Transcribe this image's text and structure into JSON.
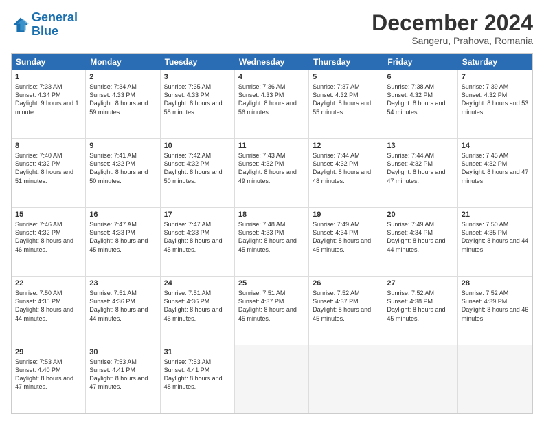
{
  "logo": {
    "line1": "General",
    "line2": "Blue"
  },
  "title": "December 2024",
  "subtitle": "Sangeru, Prahova, Romania",
  "header_days": [
    "Sunday",
    "Monday",
    "Tuesday",
    "Wednesday",
    "Thursday",
    "Friday",
    "Saturday"
  ],
  "weeks": [
    [
      {
        "day": "1",
        "sunrise": "Sunrise: 7:33 AM",
        "sunset": "Sunset: 4:34 PM",
        "daylight": "Daylight: 9 hours and 1 minute."
      },
      {
        "day": "2",
        "sunrise": "Sunrise: 7:34 AM",
        "sunset": "Sunset: 4:33 PM",
        "daylight": "Daylight: 8 hours and 59 minutes."
      },
      {
        "day": "3",
        "sunrise": "Sunrise: 7:35 AM",
        "sunset": "Sunset: 4:33 PM",
        "daylight": "Daylight: 8 hours and 58 minutes."
      },
      {
        "day": "4",
        "sunrise": "Sunrise: 7:36 AM",
        "sunset": "Sunset: 4:33 PM",
        "daylight": "Daylight: 8 hours and 56 minutes."
      },
      {
        "day": "5",
        "sunrise": "Sunrise: 7:37 AM",
        "sunset": "Sunset: 4:32 PM",
        "daylight": "Daylight: 8 hours and 55 minutes."
      },
      {
        "day": "6",
        "sunrise": "Sunrise: 7:38 AM",
        "sunset": "Sunset: 4:32 PM",
        "daylight": "Daylight: 8 hours and 54 minutes."
      },
      {
        "day": "7",
        "sunrise": "Sunrise: 7:39 AM",
        "sunset": "Sunset: 4:32 PM",
        "daylight": "Daylight: 8 hours and 53 minutes."
      }
    ],
    [
      {
        "day": "8",
        "sunrise": "Sunrise: 7:40 AM",
        "sunset": "Sunset: 4:32 PM",
        "daylight": "Daylight: 8 hours and 51 minutes."
      },
      {
        "day": "9",
        "sunrise": "Sunrise: 7:41 AM",
        "sunset": "Sunset: 4:32 PM",
        "daylight": "Daylight: 8 hours and 50 minutes."
      },
      {
        "day": "10",
        "sunrise": "Sunrise: 7:42 AM",
        "sunset": "Sunset: 4:32 PM",
        "daylight": "Daylight: 8 hours and 50 minutes."
      },
      {
        "day": "11",
        "sunrise": "Sunrise: 7:43 AM",
        "sunset": "Sunset: 4:32 PM",
        "daylight": "Daylight: 8 hours and 49 minutes."
      },
      {
        "day": "12",
        "sunrise": "Sunrise: 7:44 AM",
        "sunset": "Sunset: 4:32 PM",
        "daylight": "Daylight: 8 hours and 48 minutes."
      },
      {
        "day": "13",
        "sunrise": "Sunrise: 7:44 AM",
        "sunset": "Sunset: 4:32 PM",
        "daylight": "Daylight: 8 hours and 47 minutes."
      },
      {
        "day": "14",
        "sunrise": "Sunrise: 7:45 AM",
        "sunset": "Sunset: 4:32 PM",
        "daylight": "Daylight: 8 hours and 47 minutes."
      }
    ],
    [
      {
        "day": "15",
        "sunrise": "Sunrise: 7:46 AM",
        "sunset": "Sunset: 4:32 PM",
        "daylight": "Daylight: 8 hours and 46 minutes."
      },
      {
        "day": "16",
        "sunrise": "Sunrise: 7:47 AM",
        "sunset": "Sunset: 4:33 PM",
        "daylight": "Daylight: 8 hours and 45 minutes."
      },
      {
        "day": "17",
        "sunrise": "Sunrise: 7:47 AM",
        "sunset": "Sunset: 4:33 PM",
        "daylight": "Daylight: 8 hours and 45 minutes."
      },
      {
        "day": "18",
        "sunrise": "Sunrise: 7:48 AM",
        "sunset": "Sunset: 4:33 PM",
        "daylight": "Daylight: 8 hours and 45 minutes."
      },
      {
        "day": "19",
        "sunrise": "Sunrise: 7:49 AM",
        "sunset": "Sunset: 4:34 PM",
        "daylight": "Daylight: 8 hours and 45 minutes."
      },
      {
        "day": "20",
        "sunrise": "Sunrise: 7:49 AM",
        "sunset": "Sunset: 4:34 PM",
        "daylight": "Daylight: 8 hours and 44 minutes."
      },
      {
        "day": "21",
        "sunrise": "Sunrise: 7:50 AM",
        "sunset": "Sunset: 4:35 PM",
        "daylight": "Daylight: 8 hours and 44 minutes."
      }
    ],
    [
      {
        "day": "22",
        "sunrise": "Sunrise: 7:50 AM",
        "sunset": "Sunset: 4:35 PM",
        "daylight": "Daylight: 8 hours and 44 minutes."
      },
      {
        "day": "23",
        "sunrise": "Sunrise: 7:51 AM",
        "sunset": "Sunset: 4:36 PM",
        "daylight": "Daylight: 8 hours and 44 minutes."
      },
      {
        "day": "24",
        "sunrise": "Sunrise: 7:51 AM",
        "sunset": "Sunset: 4:36 PM",
        "daylight": "Daylight: 8 hours and 45 minutes."
      },
      {
        "day": "25",
        "sunrise": "Sunrise: 7:51 AM",
        "sunset": "Sunset: 4:37 PM",
        "daylight": "Daylight: 8 hours and 45 minutes."
      },
      {
        "day": "26",
        "sunrise": "Sunrise: 7:52 AM",
        "sunset": "Sunset: 4:37 PM",
        "daylight": "Daylight: 8 hours and 45 minutes."
      },
      {
        "day": "27",
        "sunrise": "Sunrise: 7:52 AM",
        "sunset": "Sunset: 4:38 PM",
        "daylight": "Daylight: 8 hours and 45 minutes."
      },
      {
        "day": "28",
        "sunrise": "Sunrise: 7:52 AM",
        "sunset": "Sunset: 4:39 PM",
        "daylight": "Daylight: 8 hours and 46 minutes."
      }
    ],
    [
      {
        "day": "29",
        "sunrise": "Sunrise: 7:53 AM",
        "sunset": "Sunset: 4:40 PM",
        "daylight": "Daylight: 8 hours and 47 minutes."
      },
      {
        "day": "30",
        "sunrise": "Sunrise: 7:53 AM",
        "sunset": "Sunset: 4:41 PM",
        "daylight": "Daylight: 8 hours and 47 minutes."
      },
      {
        "day": "31",
        "sunrise": "Sunrise: 7:53 AM",
        "sunset": "Sunset: 4:41 PM",
        "daylight": "Daylight: 8 hours and 48 minutes."
      },
      {
        "day": "",
        "sunrise": "",
        "sunset": "",
        "daylight": ""
      },
      {
        "day": "",
        "sunrise": "",
        "sunset": "",
        "daylight": ""
      },
      {
        "day": "",
        "sunrise": "",
        "sunset": "",
        "daylight": ""
      },
      {
        "day": "",
        "sunrise": "",
        "sunset": "",
        "daylight": ""
      }
    ]
  ]
}
